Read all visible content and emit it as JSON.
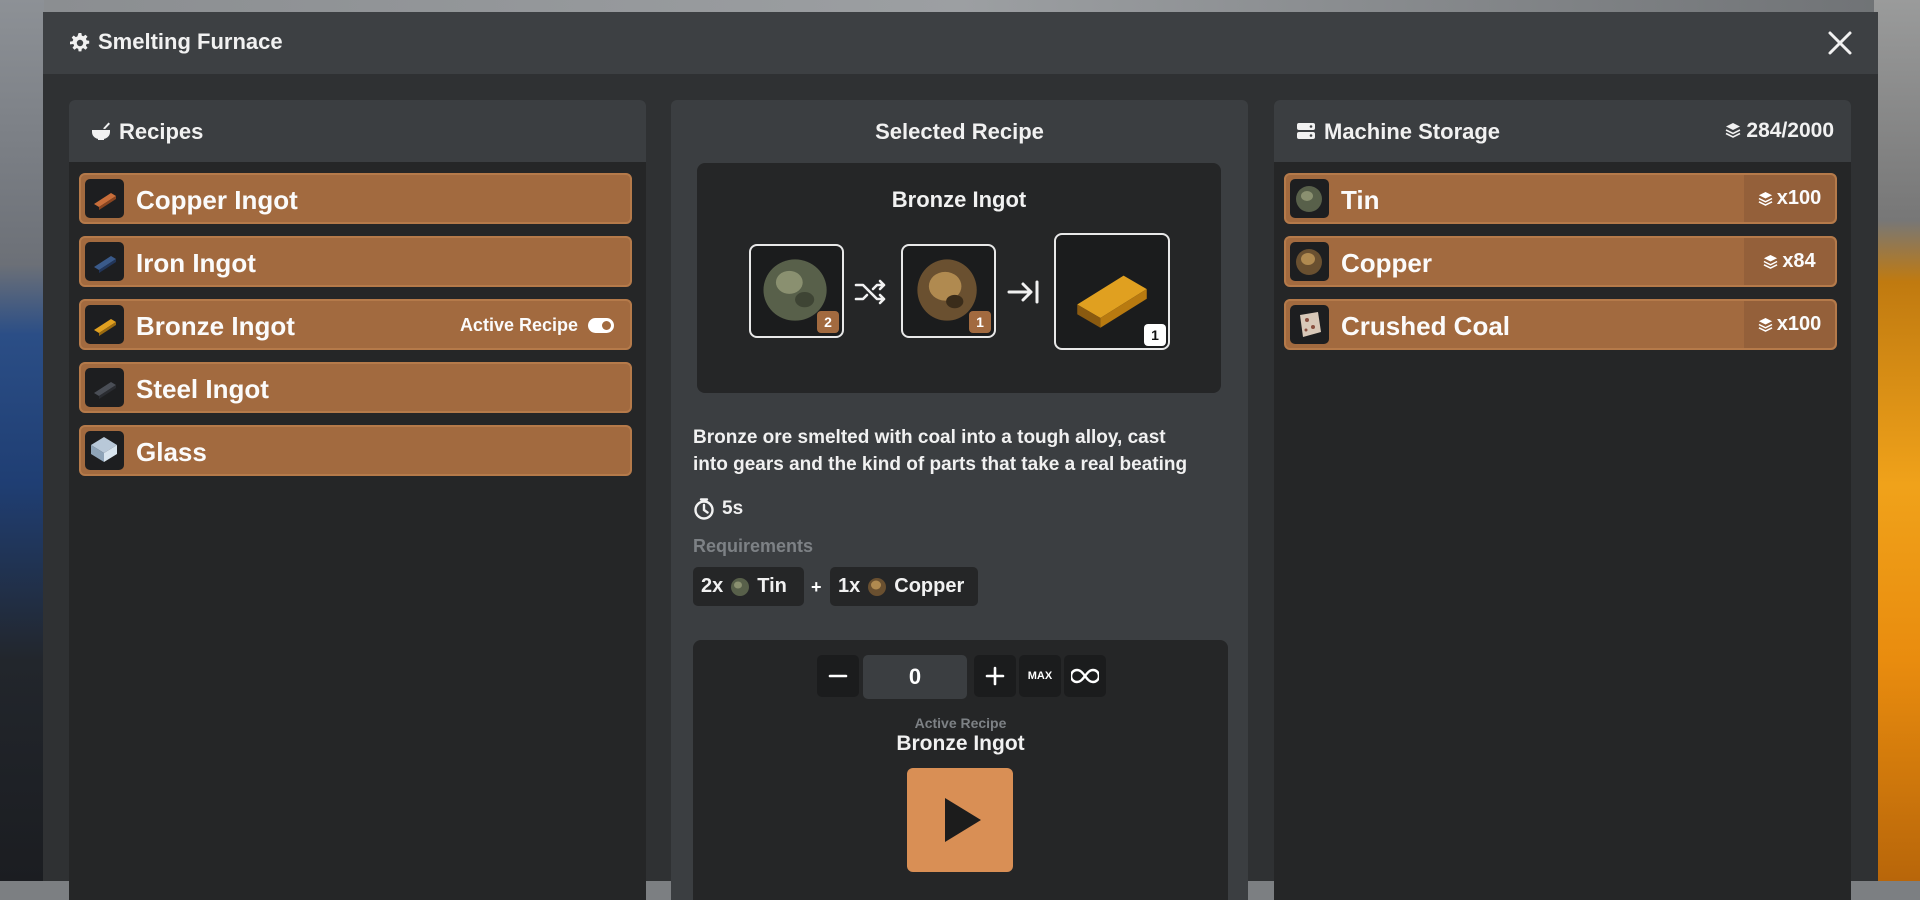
{
  "window": {
    "title": "Smelting Furnace"
  },
  "recipes": {
    "title": "Recipes",
    "items": [
      {
        "label": "Copper Ingot",
        "icon": "copper-ingot-icon",
        "color": "#c96e3a"
      },
      {
        "label": "Iron Ingot",
        "icon": "iron-ingot-icon",
        "color": "#3a5a8a"
      },
      {
        "label": "Bronze Ingot",
        "icon": "bronze-ingot-icon",
        "color": "#e0a020",
        "active_label": "Active Recipe"
      },
      {
        "label": "Steel Ingot",
        "icon": "steel-ingot-icon",
        "color": "#3a3d44"
      },
      {
        "label": "Glass",
        "icon": "glass-icon",
        "color": "#b8c8d8"
      }
    ]
  },
  "selected": {
    "title": "Selected Recipe",
    "name": "Bronze Ingot",
    "inputs": [
      {
        "icon": "tin-ore-icon",
        "count": "2"
      },
      {
        "icon": "copper-ore-icon",
        "count": "1"
      }
    ],
    "output": {
      "icon": "bronze-ingot-icon",
      "count": "1"
    },
    "description_line1": "Bronze ore smelted with coal into a tough alloy, cast",
    "description_line2": "into gears and the kind of parts that take a real beating",
    "time": "5s",
    "requirements_label": "Requirements",
    "requirements": [
      {
        "qty": "2x",
        "name": "Tin"
      },
      {
        "qty": "1x",
        "name": "Copper"
      }
    ],
    "plus": "+"
  },
  "craft": {
    "quantity": "0",
    "max_label": "MAX",
    "active_label": "Active Recipe",
    "active_name": "Bronze Ingot"
  },
  "storage": {
    "title": "Machine Storage",
    "count": "284/2000",
    "items": [
      {
        "label": "Tin",
        "qty": "x100"
      },
      {
        "label": "Copper",
        "qty": "x84"
      },
      {
        "label": "Crushed Coal",
        "qty": "x100"
      }
    ]
  },
  "colors": {
    "accent": "#a26a3f",
    "play": "#d98f55",
    "bg": "#2f3133"
  }
}
